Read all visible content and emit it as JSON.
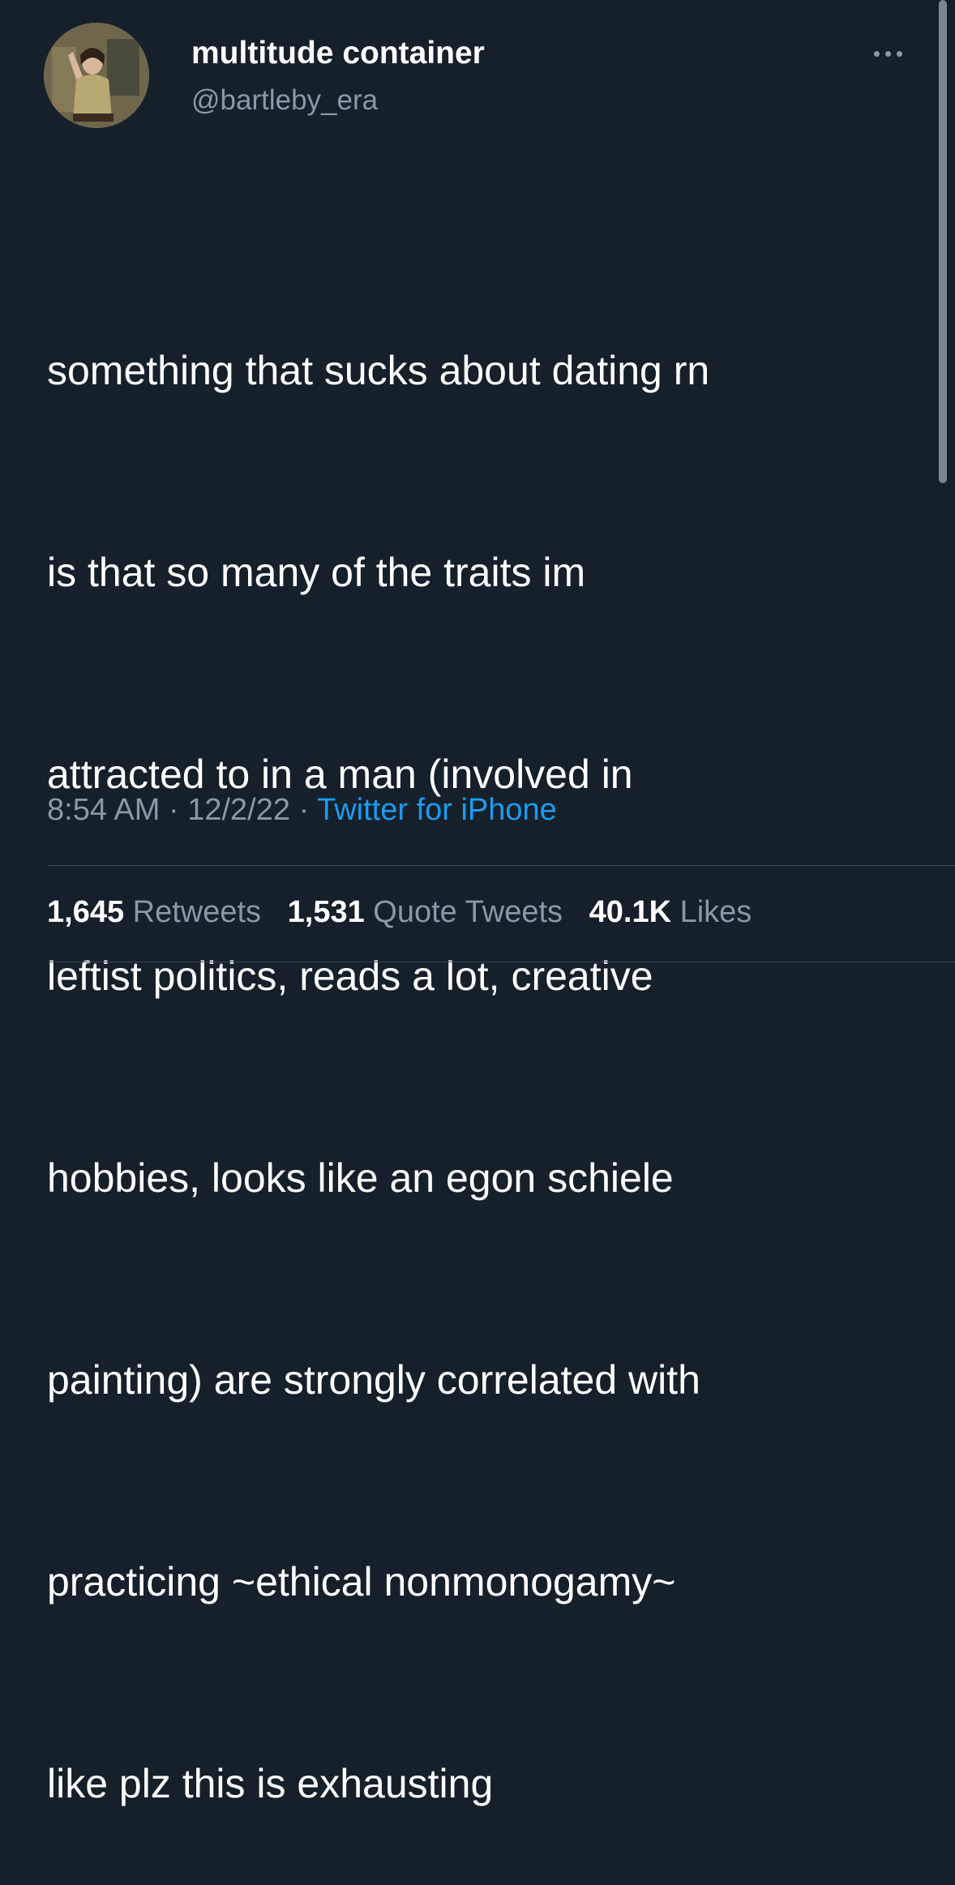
{
  "author": {
    "display_name": "multitude container",
    "handle": "@bartleby_era",
    "avatar": "profile-photo"
  },
  "more_icon": "more-horizontal-icon",
  "tweet": {
    "lines": [
      "something that sucks about dating rn",
      "is that so many of the traits im",
      "attracted to in a man (involved in",
      "leftist politics, reads a lot, creative",
      "hobbies, looks like an egon schiele",
      "painting) are strongly correlated with",
      "practicing ~ethical nonmonogamy~",
      "like plz this is exhausting"
    ]
  },
  "meta": {
    "time": "8:54 AM",
    "separator": "·",
    "date": "12/2/22",
    "source": "Twitter for iPhone"
  },
  "stats": {
    "retweets_count": "1,645",
    "retweets_label": "Retweets",
    "quotes_count": "1,531",
    "quotes_label": "Quote Tweets",
    "likes_count": "40.1K",
    "likes_label": "Likes"
  },
  "colors": {
    "background": "#15202b",
    "text_primary": "#ffffff",
    "text_secondary": "#8b98a5",
    "link": "#1d9bf0",
    "divider": "#38444d"
  }
}
